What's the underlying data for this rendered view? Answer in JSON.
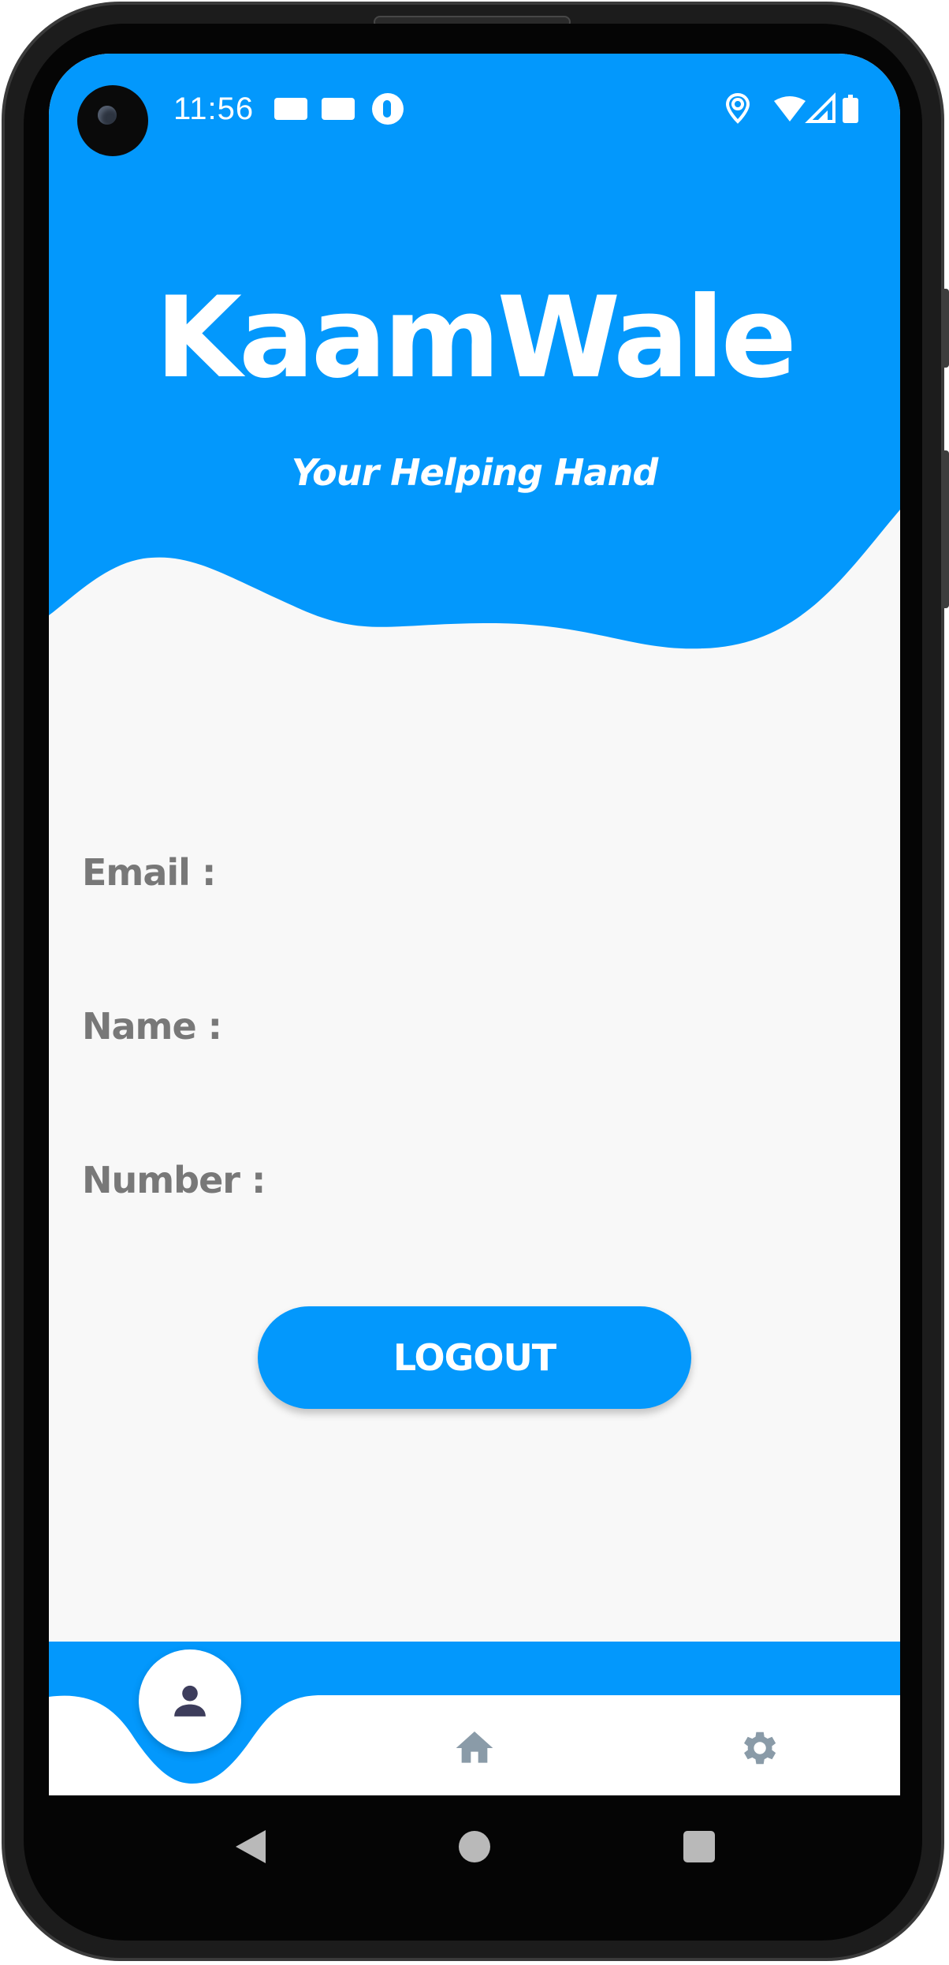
{
  "status_bar": {
    "time": "11:56",
    "icons": [
      "notification-icon",
      "notification-icon",
      "notification-icon",
      "location-icon",
      "wifi-icon",
      "signal-icon",
      "battery-icon"
    ]
  },
  "header": {
    "title": "KaamWale",
    "subtitle": "Your Helping Hand"
  },
  "profile": {
    "email_label": "Email :",
    "email_value": "",
    "name_label": "Name :",
    "name_value": "",
    "number_label": "Number :",
    "number_value": ""
  },
  "logout": {
    "label": "LOGOUT"
  },
  "bottom_nav": {
    "items": [
      {
        "icon": "person-icon",
        "active": true
      },
      {
        "icon": "home-icon",
        "active": false
      },
      {
        "icon": "settings-icon",
        "active": false
      }
    ]
  },
  "system_nav": [
    "back-icon",
    "home-circle-icon",
    "recents-icon"
  ],
  "colors": {
    "accent": "#0398fc",
    "background": "#f8f8f8",
    "label_text": "#787878",
    "nav_icon": "#8a9ba8",
    "active_icon": "#3d3d5c"
  }
}
